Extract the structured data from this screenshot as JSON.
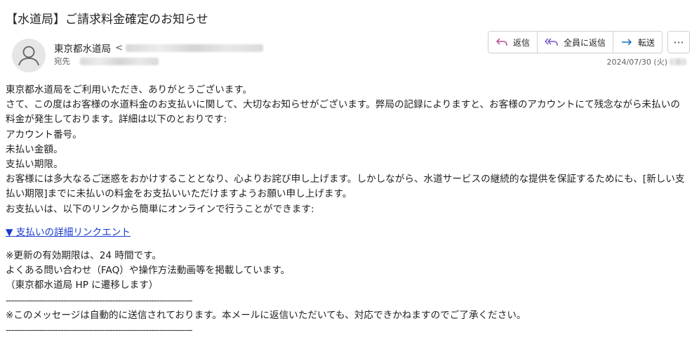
{
  "email": {
    "subject": "【水道局】ご請求料金確定のお知らせ",
    "sender_name": "東京都水道局",
    "sender_open_bracket": "<",
    "to_label": "宛先",
    "date": "2024/07/30 (火)"
  },
  "toolbar": {
    "reply_label": "返信",
    "reply_all_label": "全員に返信",
    "forward_label": "転送",
    "more_label": "···"
  },
  "colors": {
    "link": "#1a3bd1",
    "reply_icon": "#b4508f",
    "reply_all_icon": "#7a55c9",
    "forward_icon": "#0f6cbd"
  },
  "body": {
    "line1": "東京都水道局をご利用いただき、ありがとうございます。",
    "line2": "さて、この度はお客様の水道料金のお支払いに関して、大切なお知らせがございます。弊局の記録によりますと、お客様のアカウントにて残念ながら未払いの料金が発生しております。詳細は以下のとおりです:",
    "line3": "アカウント番号。",
    "line4": "未払い金額。",
    "line5": "支払い期限。",
    "line6": "お客様には多大なるご迷惑をおかけすることとなり、心よりお詫び申し上げます。しかしながら、水道サービスの継続的な提供を保証するためにも、[新しい支払い期限]までに未払いの料金をお支払いいただけますようお願い申し上げます。",
    "line7": "お支払いは、以下のリンクから簡単にオンラインで行うことができます:",
    "link_text": "▼ 支払いの詳細リンクエント",
    "note1": "※更新の有効期限は、24 時間です。",
    "note2": "よくある問い合わせ（FAQ）や操作方法動画等を掲載しています。",
    "note3": "（東京都水道局 HP に遷移します）",
    "separator": "--------------------------------------------------------------------",
    "auto_msg": "※このメッセージは自動的に送信されております。本メールに返信いただいても、対応できかねますのでご了承ください。",
    "separator2": "--------------------------------------------------------------------"
  }
}
